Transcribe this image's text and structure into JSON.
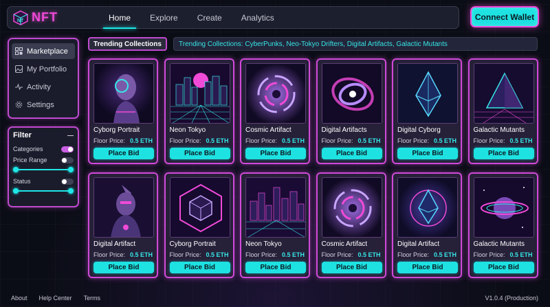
{
  "app": {
    "logo_text": "NFT"
  },
  "nav": {
    "items": [
      {
        "label": "Home",
        "active": true
      },
      {
        "label": "Explore",
        "active": false
      },
      {
        "label": "Create",
        "active": false
      },
      {
        "label": "Analytics",
        "active": false
      }
    ]
  },
  "header": {
    "connect_label": "Connect Wallet"
  },
  "sidebar": {
    "items": [
      {
        "label": "Marketplace",
        "icon": "grid-icon",
        "active": true
      },
      {
        "label": "My Portfolio",
        "icon": "image-icon",
        "active": false
      },
      {
        "label": "Activity",
        "icon": "pulse-icon",
        "active": false
      },
      {
        "label": "Settings",
        "icon": "gear-icon",
        "active": false
      }
    ]
  },
  "filter": {
    "title": "Filter",
    "categories_label": "Categories",
    "categories_on": true,
    "price_label": "Price Range",
    "price_on": false,
    "status_label": "Status",
    "status_on": false
  },
  "trending": {
    "label": "Trending Collections",
    "ticker": "Trending Collections: CyberPunks, Neo-Tokyo Drifters, Digital Artifacts, Galactic Mutants"
  },
  "cards": [
    {
      "name": "Cyborg Portrait",
      "price_label": "Floor Price:",
      "price": "0.5 ETH",
      "bid_label": "Place Bid",
      "art": "cyborg-portrait-art"
    },
    {
      "name": "Neon Tokyo",
      "price_label": "Floor Price:",
      "price": "0.5 ETH",
      "bid_label": "Place Bid",
      "art": "neon-city-art"
    },
    {
      "name": "Cosmic Artifact",
      "price_label": "Floor Price:",
      "price": "0.5 ETH",
      "bid_label": "Place Bid",
      "art": "cosmic-swirl-art"
    },
    {
      "name": "Digital Artifacts",
      "price_label": "Floor Price:",
      "price": "0.5 ETH",
      "bid_label": "Place Bid",
      "art": "galaxy-swirl-art"
    },
    {
      "name": "Digital Cyborg",
      "price_label": "Floor Price:",
      "price": "0.5 ETH",
      "bid_label": "Place Bid",
      "art": "ethereum-crystal-art"
    },
    {
      "name": "Galactic Mutants",
      "price_label": "Floor Price:",
      "price": "0.5 ETH",
      "bid_label": "Place Bid",
      "art": "ethereum-pyramid-art"
    },
    {
      "name": "Digital Artifact",
      "price_label": "Floor Price:",
      "price": "0.5 ETH",
      "bid_label": "Place Bid",
      "art": "robot-bust-art"
    },
    {
      "name": "Cyborg Portrait",
      "price_label": "Floor Price:",
      "price": "0.5 ETH",
      "bid_label": "Place Bid",
      "art": "hex-cube-art"
    },
    {
      "name": "Neon Tokyo",
      "price_label": "Floor Price:",
      "price": "0.5 ETH",
      "bid_label": "Place Bid",
      "art": "neon-skyline-art"
    },
    {
      "name": "Cosmic Artifact",
      "price_label": "Floor Price:",
      "price": "0.5 ETH",
      "bid_label": "Place Bid",
      "art": "cosmic-swirl-art"
    },
    {
      "name": "Digital Artifact",
      "price_label": "Floor Price:",
      "price": "0.5 ETH",
      "bid_label": "Place Bid",
      "art": "ethereum-glow-art"
    },
    {
      "name": "Galactic Mutants",
      "price_label": "Floor Price:",
      "price": "0.5 ETH",
      "bid_label": "Place Bid",
      "art": "planet-orbit-art"
    }
  ],
  "footer": {
    "links": [
      "About",
      "Help Center",
      "Terms"
    ],
    "version": "V1.0.4 (Production)"
  },
  "colors": {
    "accent_cyan": "#1ee2e2",
    "accent_magenta": "#d04ad8",
    "bg": "#0b0d16"
  }
}
